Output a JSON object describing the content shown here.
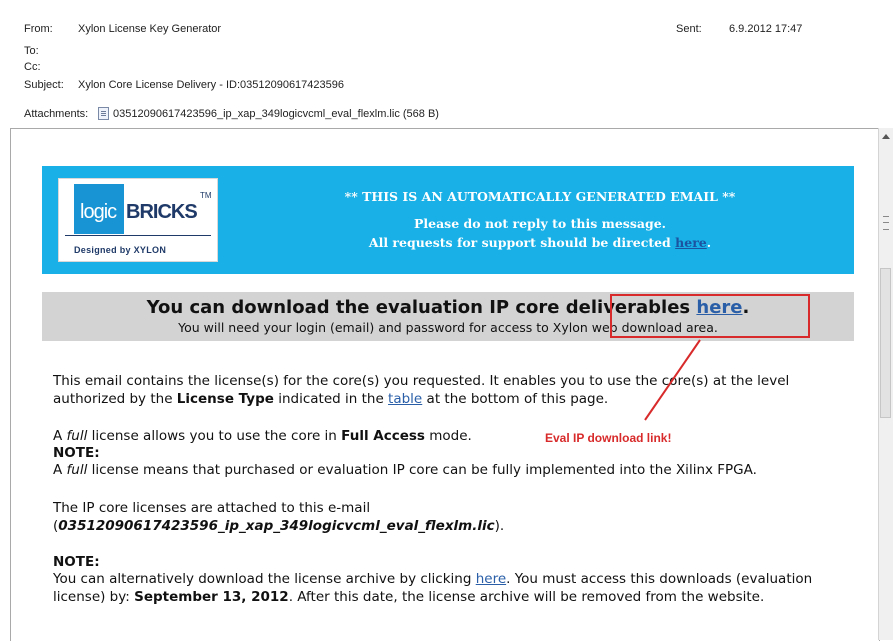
{
  "header": {
    "from_label": "From:",
    "from_value": "Xylon License Key Generator",
    "to_label": "To:",
    "cc_label": "Cc:",
    "subject_label": "Subject:",
    "subject_value": "Xylon Core License Delivery - ID:03512090617423596",
    "sent_label": "Sent:",
    "sent_value": "6.9.2012 17:47",
    "attachments_label": "Attachments:",
    "attachment_name": "03512090617423596_ip_xap_349logicvcml_eval_flexlm.lic (568 B)"
  },
  "banner": {
    "logo_logic": "logic",
    "logo_bricks": "BRICKS",
    "logo_tm": "TM",
    "logo_tagline": "Designed by XYLON",
    "line1": "** THIS IS AN AUTOMATICALLY GENERATED EMAIL **",
    "line2": "Please do not reply to this message.",
    "line3_prefix": "All requests for support should be directed ",
    "line3_link": "here",
    "line3_suffix": "."
  },
  "download": {
    "title_prefix": "You can download the evaluation IP core deliverables ",
    "title_link": "here",
    "title_suffix": ".",
    "subtitle": "You will need your login (email) and password for access to Xylon web download area."
  },
  "annotation": {
    "label": "Eval IP download link!",
    "color": "#d82a2a"
  },
  "body": {
    "p1_a": "This email contains the license(s) for the core(s) you requested. It enables you to use the core(s) at the level authorized by the ",
    "p1_bold": "License Type",
    "p1_b": " indicated in the ",
    "p1_link": "table",
    "p1_c": " at the bottom of this page.",
    "p2_a": "A ",
    "p2_italic": "full",
    "p2_b": " license allows you to use the core in ",
    "p2_bold": "Full Access",
    "p2_c": " mode.",
    "note1_label": "NOTE:",
    "note1_a": "A ",
    "note1_italic": "full",
    "note1_b": " license means that purchased or evaluation IP core can be fully implemented into the Xilinx FPGA.",
    "p3_line1": "The IP core licenses are attached to this e-mail",
    "p3_open": "(",
    "p3_file": "03512090617423596_ip_xap_349logicvcml_eval_flexlm.lic",
    "p3_close": ").",
    "note2_label": "NOTE:",
    "note2_a": "You can alternatively download the license archive by clicking ",
    "note2_link": "here",
    "note2_b": ". You must access this downloads (evaluation license) by: ",
    "note2_date": "September 13, 2012",
    "note2_c": ". After this date, the license archive will be removed from the website."
  },
  "colors": {
    "banner": "#18b0e6",
    "band": "#d3d3d3",
    "link": "#2a5fa8",
    "annotation": "#d82a2a"
  }
}
